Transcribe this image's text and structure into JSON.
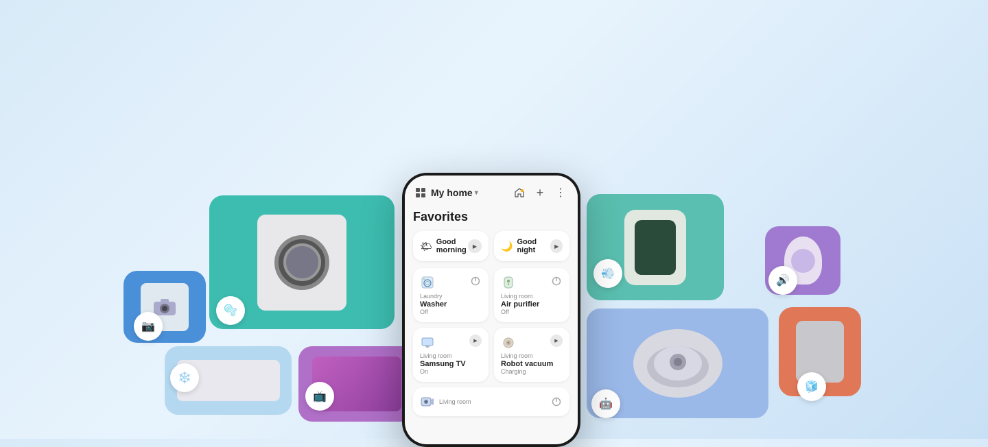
{
  "app": {
    "background_color": "#d8eaf8"
  },
  "phone": {
    "header": {
      "grid_icon": "⊞",
      "title": "My home",
      "dropdown_arrow": "▾",
      "smart_icon": "🏠",
      "add_icon": "+",
      "menu_icon": "⋮"
    },
    "favorites_label": "Favorites",
    "routines": [
      {
        "emoji": "🌤",
        "label": "Good morning",
        "has_play": true
      },
      {
        "emoji": "🌙",
        "label": "Good night",
        "has_play": true
      }
    ],
    "devices": [
      {
        "icon": "washer",
        "room": "Laundry",
        "name": "Washer",
        "status": "Off",
        "has_power": true,
        "has_play": false
      },
      {
        "icon": "purifier",
        "room": "Living room",
        "name": "Air purifier",
        "status": "Off",
        "has_power": true,
        "has_play": false
      },
      {
        "icon": "tv",
        "room": "Living room",
        "name": "Samsung TV",
        "status": "On",
        "has_power": false,
        "has_play": true
      },
      {
        "icon": "vacuum",
        "room": "Living room",
        "name": "Robot vacuum",
        "status": "Charging",
        "has_power": false,
        "has_play": true
      }
    ],
    "bottom_device": {
      "icon": "camera",
      "room": "Living room",
      "name": "",
      "has_power": true
    }
  },
  "background_cards": [
    {
      "id": "washer",
      "color": "#3dbdb0",
      "label": "Washing Machine"
    },
    {
      "id": "camera",
      "color": "#4a90d9",
      "label": "Camera"
    },
    {
      "id": "ac",
      "color": "#b3d8f0",
      "label": "Air Conditioner"
    },
    {
      "id": "tv",
      "color": "#b070c8",
      "label": "TV"
    },
    {
      "id": "purifier",
      "color": "#5abfb0",
      "label": "Air Purifier"
    },
    {
      "id": "speaker",
      "color": "#a07ad0",
      "label": "Smart Speaker"
    },
    {
      "id": "vacuum",
      "color": "#9ab8e8",
      "label": "Robot Vacuum"
    },
    {
      "id": "fridge",
      "color": "#e07858",
      "label": "Refrigerator"
    }
  ]
}
